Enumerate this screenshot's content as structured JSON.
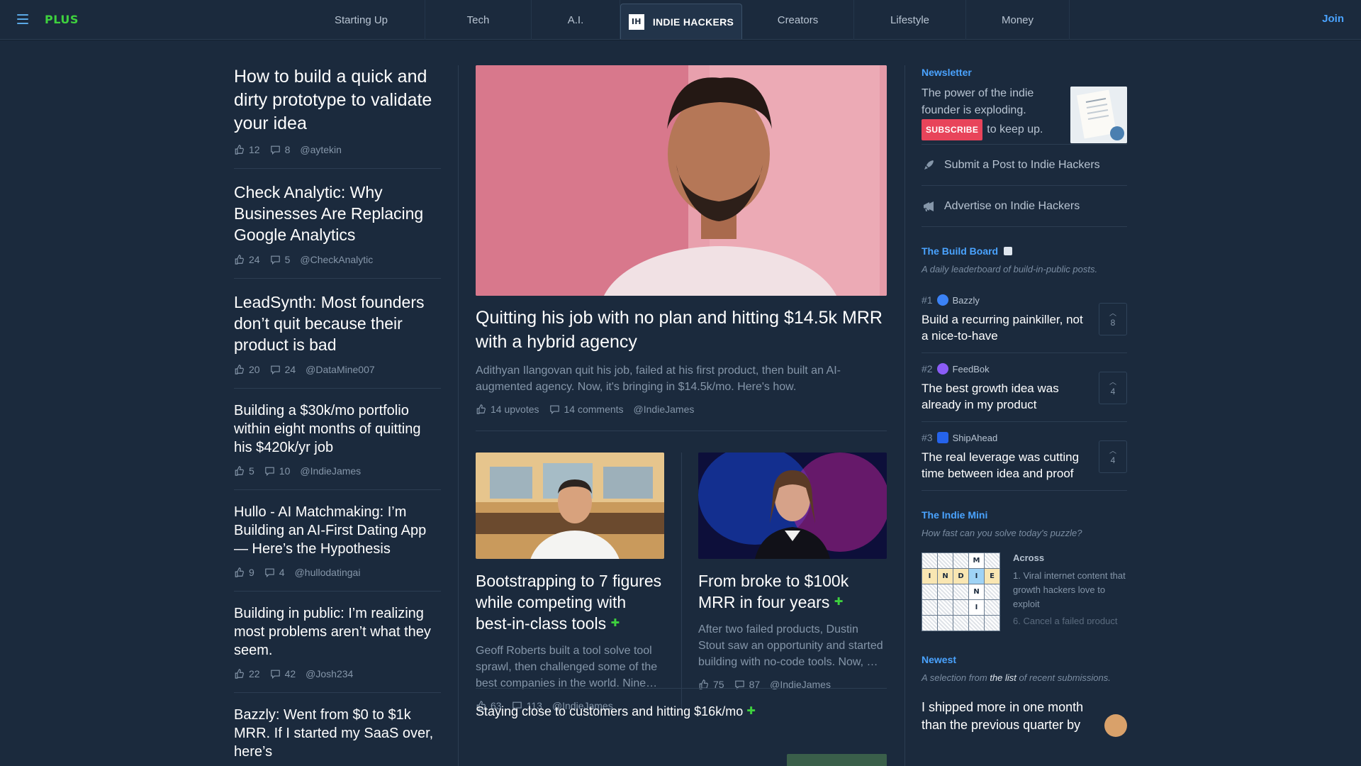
{
  "nav": {
    "logo": "PLUS",
    "tabs": [
      {
        "label": "Starting Up"
      },
      {
        "label": "Tech"
      },
      {
        "label": "A.I."
      },
      {
        "label": "INDIE HACKERS",
        "badge": "IH",
        "active": true
      },
      {
        "label": "Creators"
      },
      {
        "label": "Lifestyle"
      },
      {
        "label": "Money"
      }
    ],
    "join": "Join"
  },
  "left_posts": [
    {
      "title": "How to build a quick and dirty prototype to validate your idea",
      "upvotes": "12",
      "comments": "8",
      "author": "@aytekin"
    },
    {
      "title": "Check Analytic: Why Businesses Are Replacing Google Analytics",
      "upvotes": "24",
      "comments": "5",
      "author": "@CheckAnalytic"
    },
    {
      "title": "LeadSynth: Most founders don’t quit because their product is bad",
      "upvotes": "20",
      "comments": "24",
      "author": "@DataMine007"
    },
    {
      "title": "Building a $30k/mo portfolio within eight months of quitting his $420k/yr job",
      "upvotes": "5",
      "comments": "10",
      "author": "@IndieJames"
    },
    {
      "title": "Hullo - AI Matchmaking: I’m Building an AI-First Dating App — Here’s the Hypothesis",
      "upvotes": "9",
      "comments": "4",
      "author": "@hullodatingai"
    },
    {
      "title": "Building in public: I’m realizing most problems aren’t what they seem.",
      "upvotes": "22",
      "comments": "42",
      "author": "@Josh234"
    },
    {
      "title": "Bazzly: Went from $0 to $1k MRR. If I started my SaaS over, here’s"
    }
  ],
  "hero": {
    "title": "Quitting his job with no plan and hitting $14.5k MRR with a hybrid agency",
    "description": "Adithyan Ilangovan quit his job, failed at his first product, then built an AI-augmented agency. Now, it's bringing in $14.5k/mo. Here's how.",
    "upvotes": "14 upvotes",
    "comments": "14 comments",
    "author": "@IndieJames"
  },
  "sub_posts": [
    {
      "title": "Bootstrapping to 7 figures while competing with best-in-class tools",
      "sparkle": "✚",
      "description": "Geoff Roberts built a tool solve tool sprawl, then challenged some of the best companies in the world. Nine…",
      "upvotes": "63",
      "comments": "113",
      "author": "@IndieJames"
    },
    {
      "title": "From broke to $100k MRR in four years",
      "sparkle": "✚",
      "description": "After two failed products, Dustin Stout saw an opportunity and started building with no-code tools. Now, …",
      "upvotes": "75",
      "comments": "87",
      "author": "@IndieJames"
    }
  ],
  "bottom_teaser": {
    "title": "Staying close to customers and hitting $16k/mo",
    "sparkle": "✚"
  },
  "sidebar": {
    "newsletter": {
      "heading": "Newsletter",
      "text": "The power of the indie founder is exploding.",
      "subscribe": "SUBSCRIBE",
      "suffix": "to keep up."
    },
    "links": [
      {
        "label": "Submit a Post to Indie Hackers",
        "icon": "rocket-icon"
      },
      {
        "label": "Advertise on Indie Hackers",
        "icon": "megaphone-icon"
      }
    ],
    "build_board": {
      "heading": "The Build Board",
      "subtitle": "A daily leaderboard of build-in-public posts.",
      "items": [
        {
          "rank": "#1",
          "product": "Bazzly",
          "title": "Build a recurring painkiller, not a nice-to-have",
          "votes": "8",
          "color": "#3b82f6"
        },
        {
          "rank": "#2",
          "product": "FeedBok",
          "title": "The best growth idea was already in my product",
          "votes": "4",
          "color": "#8b5cf6"
        },
        {
          "rank": "#3",
          "product": "ShipAhead",
          "title": "The real leverage was cutting time between idea and proof",
          "votes": "4",
          "color": "#2563eb"
        }
      ]
    },
    "indie_mini": {
      "heading": "The Indie Mini",
      "subtitle": "How fast can you solve today's puzzle?",
      "grid": [
        [
          "",
          "",
          "",
          "M",
          ""
        ],
        [
          "I",
          "N",
          "D",
          "I",
          "E"
        ],
        [
          "",
          "",
          "",
          "N",
          ""
        ],
        [
          "",
          "",
          "",
          "I",
          ""
        ],
        [
          "",
          "",
          "",
          "",
          ""
        ]
      ],
      "across_label": "Across",
      "clues": [
        "1. Viral internet content that growth hackers love to exploit",
        "6. Cancel a failed product"
      ]
    },
    "newest": {
      "heading": "Newest",
      "subtitle_pre": "A selection from ",
      "subtitle_link": "the list",
      "subtitle_post": " of recent submissions.",
      "item_title": "I shipped more in one month than the previous quarter by"
    }
  }
}
